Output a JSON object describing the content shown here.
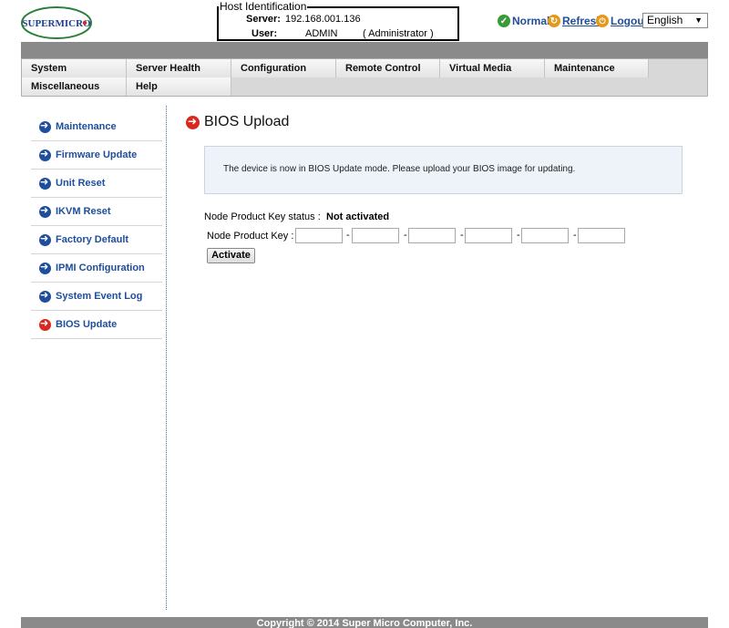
{
  "brand": {
    "logo_text": "SUPERMICRO"
  },
  "host": {
    "legend": "Host Identification",
    "server_label": "Server:",
    "server_value": "192.168.001.136",
    "user_label": "User:",
    "user_value": "ADMIN",
    "user_role": "( Administrator )"
  },
  "status": {
    "normal": "Normal",
    "refresh": "Refresh",
    "logout": "Logout",
    "language": "English"
  },
  "menu": {
    "row1": [
      "System",
      "Server Health",
      "Configuration",
      "Remote Control",
      "Virtual Media",
      "Maintenance"
    ],
    "row2": [
      "Miscellaneous",
      "Help"
    ]
  },
  "sidebar": {
    "items": [
      {
        "label": "Maintenance"
      },
      {
        "label": "Firmware Update"
      },
      {
        "label": "Unit Reset"
      },
      {
        "label": "IKVM Reset"
      },
      {
        "label": "Factory Default"
      },
      {
        "label": "IPMI Configuration"
      },
      {
        "label": "System Event Log"
      },
      {
        "label": "BIOS Update"
      }
    ]
  },
  "main": {
    "title": "BIOS Upload",
    "info": "The device is now in BIOS Update mode. Please upload your BIOS image for updating.",
    "pk_status_label": "Node Product Key status :",
    "pk_status_value": "Not activated",
    "pk_key_label": "Node Product Key :",
    "key_fields": [
      "",
      "",
      "",
      "",
      "",
      ""
    ],
    "dash": "-",
    "activate": "Activate"
  },
  "footer": {
    "text": "Copyright © 2014 Super Micro Computer, Inc."
  },
  "colors": {
    "link": "#1e4e9c",
    "active_arrow": "#d8281f",
    "bar": "#8a8a8a"
  }
}
